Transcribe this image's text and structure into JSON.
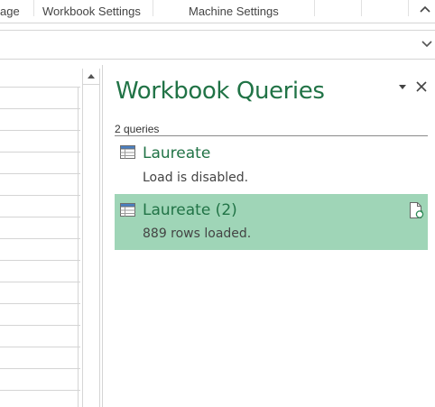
{
  "ribbon": {
    "tabs": [
      {
        "label": "age"
      },
      {
        "label": "Workbook Settings"
      },
      {
        "label": "Machine Settings"
      }
    ],
    "collapse_icon": "chevron-up-icon"
  },
  "formula_bar": {
    "expand_icon": "chevron-down-icon"
  },
  "sheet": {
    "row_lines": 15
  },
  "queries_pane": {
    "title": "Workbook Queries",
    "query_count": "2 queries",
    "menu_icon": "dropdown-triangle-icon",
    "close_icon": "close-icon",
    "accent_color": "#217346",
    "selected_color": "#9fd5b7",
    "queries": [
      {
        "name": "Laureate",
        "status": "Load is disabled.",
        "selected": false,
        "icon": "table-icon"
      },
      {
        "name": "Laureate (2)",
        "status": "889 rows loaded.",
        "selected": true,
        "icon": "table-icon",
        "action_icon": "refresh-document-icon"
      }
    ]
  }
}
